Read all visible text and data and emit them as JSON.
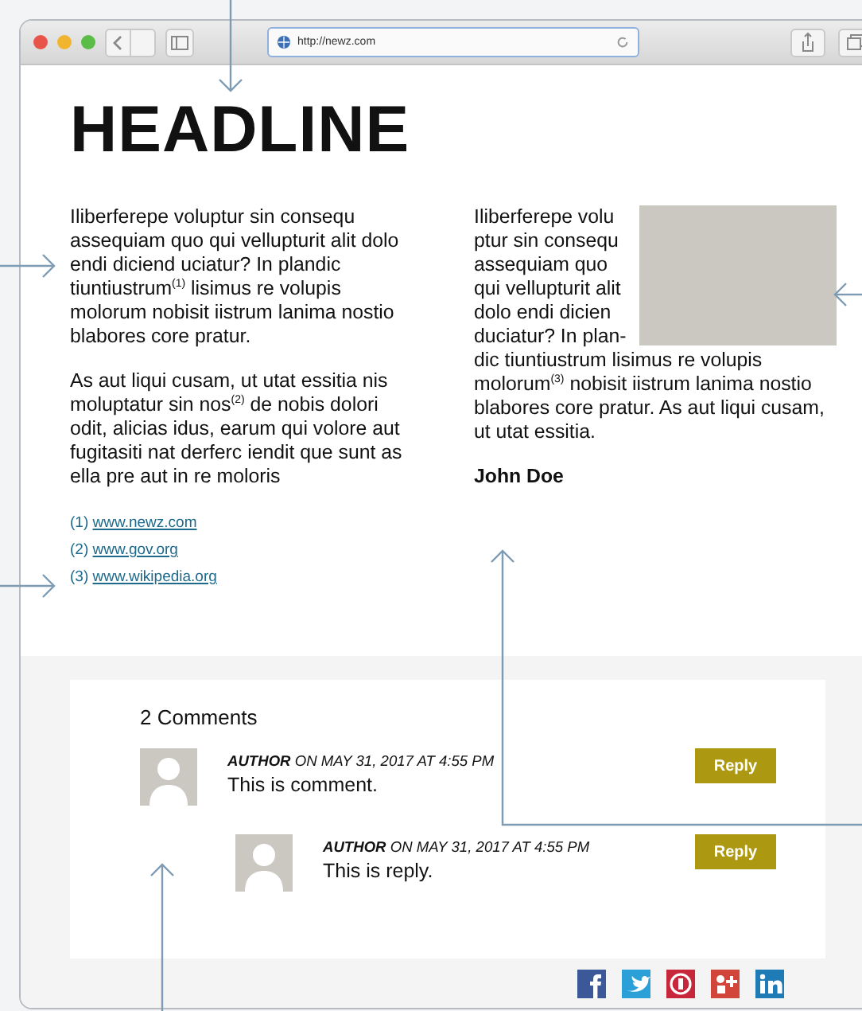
{
  "browser": {
    "url": "http://newz.com"
  },
  "headline": "HEADLINE",
  "left_column": {
    "paragraphs": [
      "Iliberferepe voluptur sin consequ assequiam quo qui vellupturit alit dolo endi diciend uciatur? In plandic tiuntiustrum$^{(1)}$ lisimus re volupis molorum nobisit iistrum lanima nostio blabores core pratur.",
      "As aut liqui cusam, ut utat essitia nis moluptatur sin nos$^{(2)}$ de nobis dolori odit, alicias idus, earum qui volore aut fugitasiti nat derferc iendit que sunt as ella pre aut in re moloris"
    ],
    "footnotes": [
      {
        "number": "(1)",
        "link": "www.newz.com"
      },
      {
        "number": "(2)",
        "link": "www.gov.org"
      },
      {
        "number": "(3)",
        "link": "www.wikipedia.org"
      }
    ]
  },
  "right_column": {
    "paragraph_beside_image": "Iliberferepe volu ptur sin consequ assequiam quo qui vellupturit alit dolo endi dicien duciatur? In plan-",
    "paragraph_below_image": "dic tiuntiustrum lisimus re volupis molorum$^{(3)}$ nobisit iistrum lanima nostio blabores core pratur. As aut liqui cusam, ut utat essitia.",
    "author": "John Doe"
  },
  "comments": {
    "title": "2 Comments",
    "items": [
      {
        "meta": "**AUTHOR** ON MAY 31, 2017 AT 4:55 PM",
        "text": "This is comment.",
        "reply": "Reply",
        "children": [
          {
            "meta": "**AUTHOR** ON MAY 31, 2017 AT 4:55 PM",
            "text": "This is reply.",
            "reply": "Reply"
          }
        ]
      }
    ]
  },
  "social": [
    {
      "kind": "facebook",
      "color": "#3b5998"
    },
    {
      "kind": "twitter",
      "color": "#2ba0d8"
    },
    {
      "kind": "pinterest",
      "color": "#c8263a"
    },
    {
      "kind": "googleplus",
      "color": "#d2453a"
    },
    {
      "kind": "linkedin",
      "color": "#1f7bb6"
    }
  ]
}
